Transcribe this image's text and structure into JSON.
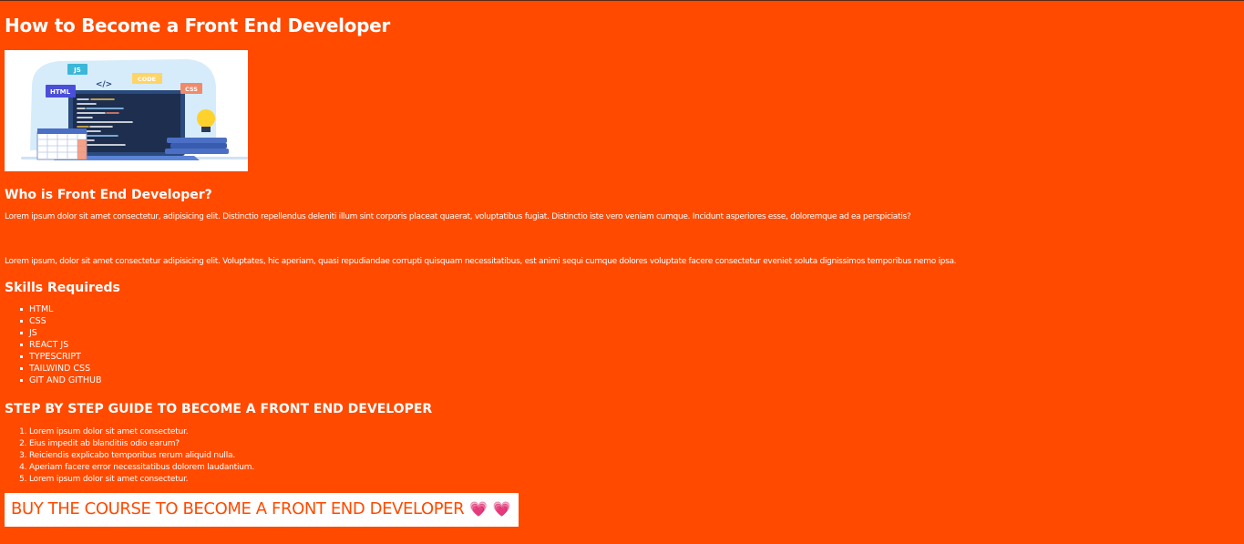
{
  "page": {
    "title": "How to Become a Front End Developer"
  },
  "hero_image": {
    "alt": "",
    "tags": [
      "JS",
      "</>",
      "CODE",
      "HTML",
      "CSS"
    ]
  },
  "intro": {
    "heading": "Who is Front End Developer?",
    "paragraph_1": "Lorem ipsum dolor sit amet consectetur, adipisicing elit. Distinctio repellendus deleniti illum sint corporis placeat quaerat, voluptatibus fugiat. Distinctio iste vero veniam cumque. Incidunt asperiores esse, doloremque ad ea perspiciatis?",
    "paragraph_2": "Lorem ipsum, dolor sit amet consectetur adipisicing elit. Voluptates, hic aperiam, quasi repudiandae corrupti quisquam necessitatibus, est animi sequi cumque dolores voluptate facere consectetur eveniet soluta dignissimos temporibus nemo ipsa."
  },
  "skills": {
    "heading": "Skills Requireds",
    "items": [
      "HTML",
      "CSS",
      "JS",
      "REACT JS",
      "TYPESCRIPT",
      "TAILWIND CSS",
      "GIT AND GITHUB"
    ]
  },
  "guide": {
    "heading": "STEP BY STEP GUIDE TO BECOME A FRONT END DEVELOPER",
    "steps": [
      "Lorem ipsum dolor sit amet consectetur.",
      "Eius impedit ab blanditiis odio earum?",
      "Reiciendis explicabo temporibus rerum aliquid nulla.",
      "Aperiam facere error necessitatibus dolorem laudantium.",
      "Lorem ipsum dolor sit amet consectetur."
    ]
  },
  "cta": {
    "label": "BUY THE COURSE TO BECOME A FRONT END DEVELOPER",
    "hearts": [
      "💗",
      "💗"
    ]
  },
  "colors": {
    "background": "#ff4a00",
    "text": "#ffffff",
    "button_bg": "#ffffff",
    "button_text": "#ff4a00"
  }
}
